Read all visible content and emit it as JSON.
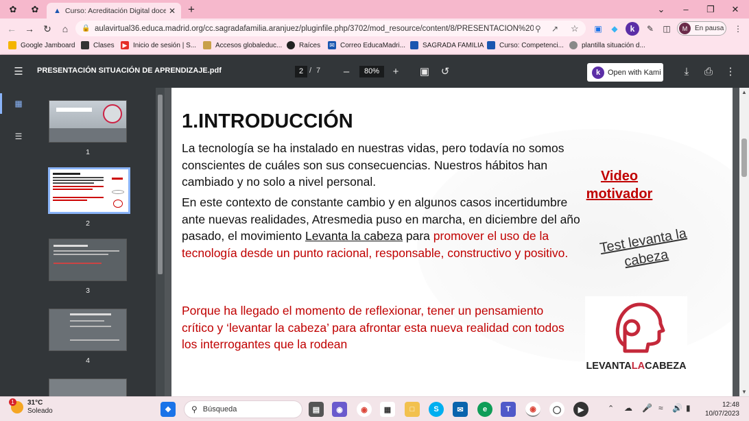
{
  "browser": {
    "tab_title": "Curso: Acreditación Digital docen",
    "url": "aulavirtual36.educa.madrid.org/cc.sagradafamilia.aranjuez/pluginfile.php/3702/mod_resource/content/8/PRESENTACIÓN%20%...",
    "profile_status": "En pausa",
    "profile_initial": "M",
    "bookmarks": [
      "Google Jamboard",
      "Clases",
      "Inicio de sesión | S...",
      "Accesos globaleduc...",
      "Raíces",
      "Correo EducaMadri...",
      "SAGRADA FAMILIA",
      "Curso: Competenci...",
      "plantilla situación d..."
    ]
  },
  "pdf": {
    "file_title": "PRESENTACIÓN SITUACIÓN DE APRENDIZAJE.pdf",
    "current_page": "2",
    "separator": "/",
    "total_pages": "7",
    "zoom": "80%",
    "kami_label": "Open with Kami",
    "thumbnails": [
      "1",
      "2",
      "3",
      "4"
    ]
  },
  "slide": {
    "heading": "1.INTRODUCCIÓN",
    "p1": "La tecnología se ha instalado en nuestras vidas, pero todavía no somos conscientes de cuáles son sus consecuencias. Nuestros hábitos han cambiado y no solo a nivel personal.",
    "p2_start": "En este contexto de constante cambio y en algunos casos incertidumbre ante nuevas realidades,  Atresmedia puso en marcha, en diciembre del año pasado, el movimiento ",
    "p2_link": "Levanta la cabeza",
    "p2_mid": " para ",
    "p2_red": "promover el uso de la tecnología desde un punto racional, responsable, constructivo y positivo.",
    "p3": " Porque ha llegado el momento de reflexionar, tener un pensamiento crítico y ‘levantar la cabeza’ para afrontar esta nueva realidad con       todos los interrogantes que la rodean",
    "video_link": "Video motivador",
    "test_link": "Test levanta la cabeza",
    "logo_pre": "LEVANTA",
    "logo_mid": "LA",
    "logo_post": "CABEZA"
  },
  "taskbar": {
    "temperature": "31°C",
    "weather": "Soleado",
    "badge": "1",
    "search_placeholder": "Búsqueda",
    "time": "12:48",
    "date": "10/07/2023"
  }
}
